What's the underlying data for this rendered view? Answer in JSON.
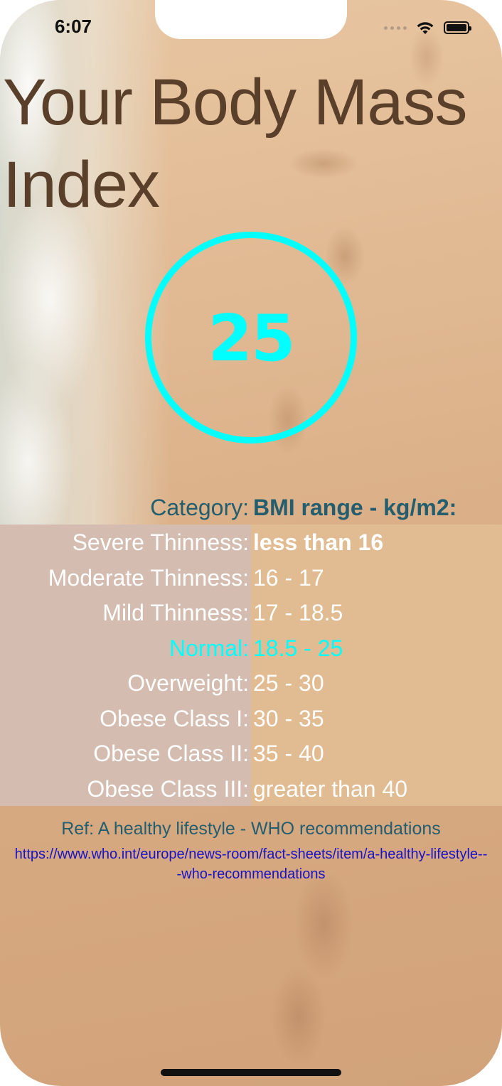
{
  "status_bar": {
    "time": "6:07"
  },
  "title": "Your Body Mass Index",
  "bmi": {
    "value": "25",
    "ring_color": "#00FFFF"
  },
  "table": {
    "header_category": "Category:",
    "header_range": "BMI range - kg/m2:",
    "rows": [
      {
        "category": "Severe Thinness:",
        "range": "less than 16"
      },
      {
        "category": "Moderate Thinness:",
        "range": "16 - 17"
      },
      {
        "category": "Mild Thinness:",
        "range": "17 - 18.5"
      },
      {
        "category": "Normal:",
        "range": "18.5 - 25"
      },
      {
        "category": "Overweight:",
        "range": "25 - 30"
      },
      {
        "category": "Obese Class I:",
        "range": "30 - 35"
      },
      {
        "category": "Obese Class II:",
        "range": "35 - 40"
      },
      {
        "category": "Obese Class III:",
        "range": "greater than 40"
      }
    ],
    "highlighted_category": "Normal:",
    "highlight_color": "#00FFFF"
  },
  "reference": {
    "title": "Ref: A healthy lifestyle - WHO recommendations",
    "url": "https://www.who.int/europe/news-room/fact-sheets/item/a-healthy-lifestyle---who-recommendations"
  },
  "icons": {
    "signal": "cellular-signal-icon",
    "wifi": "wifi-icon",
    "battery": "battery-icon"
  }
}
